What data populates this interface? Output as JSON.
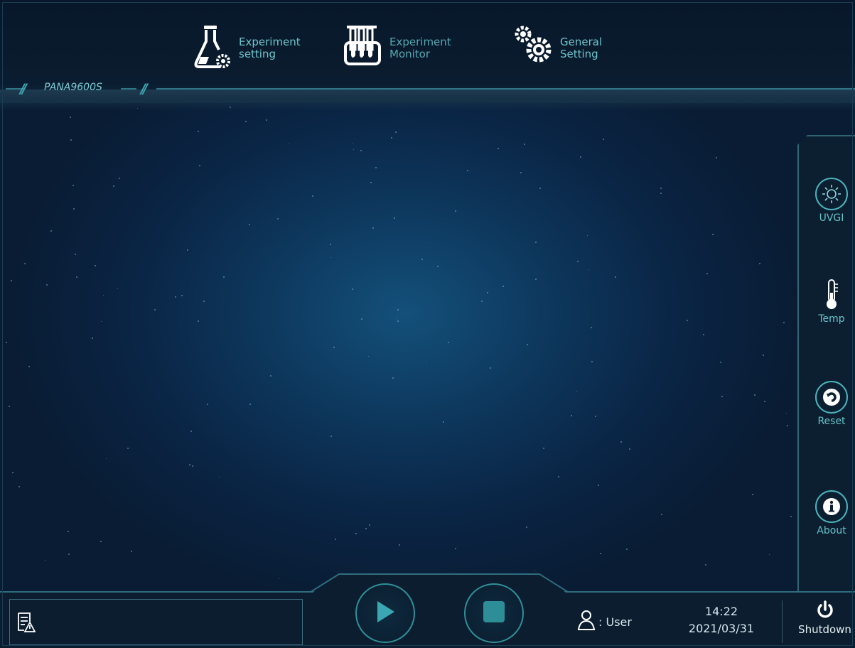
{
  "brand": {
    "name": "PANA9600S"
  },
  "nav": [
    {
      "line1": "Experiment",
      "line2": "setting",
      "icon": "flask-gear-icon"
    },
    {
      "line1": "Experiment",
      "line2": "Monitor",
      "icon": "test-tubes-icon"
    },
    {
      "line1": "General",
      "line2": "Setting",
      "icon": "gears-icon"
    }
  ],
  "side": {
    "uvgi": "UVGI",
    "temp": "Temp",
    "reset": "Reset",
    "about": "About"
  },
  "bottom": {
    "user_label": ": User",
    "time": "14:22",
    "date": "2021/03/31",
    "shutdown": "Shutdown"
  },
  "colors": {
    "accent": "#4bb3bd",
    "background": "#0d355a",
    "panel": "#0b1d2e"
  }
}
